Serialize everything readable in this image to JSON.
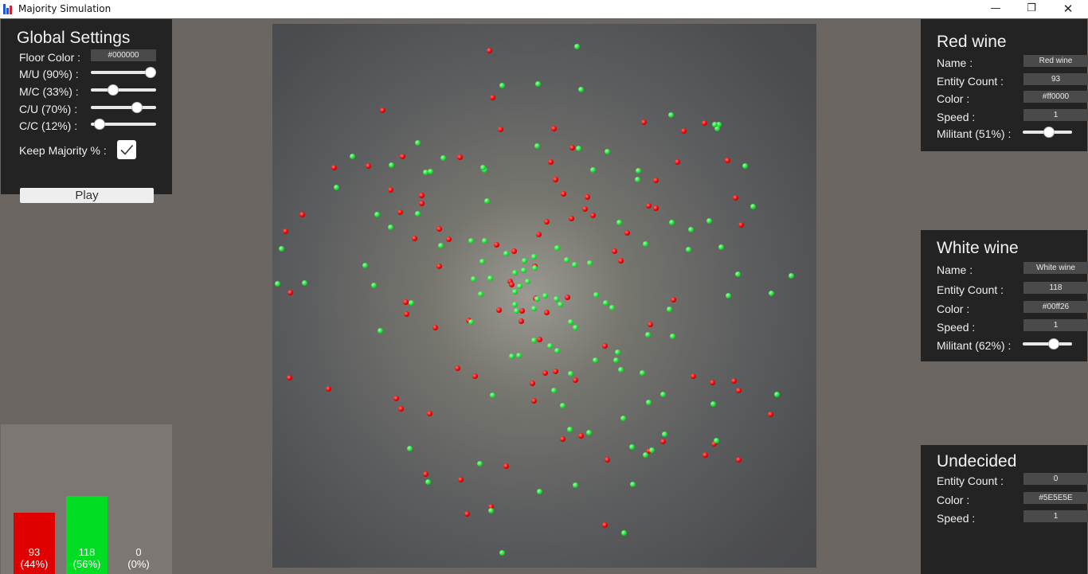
{
  "window": {
    "title": "Majority Simulation",
    "minimize": "—",
    "restore": "❐",
    "close": "✕",
    "icon": "bar-chart-app-icon"
  },
  "global": {
    "heading": "Global Settings",
    "floor_label": "Floor Color :",
    "floor_value": "#000000",
    "mu_label": "M/U (90%) :",
    "mu_value": 0.9,
    "mc_label": "M/C (33%) :",
    "mc_value": 0.33,
    "cu_label": "C/U (70%) :",
    "cu_value": 0.7,
    "cc_label": "C/C (12%) :",
    "cc_value": 0.12,
    "keep_label": "Keep Majority % :",
    "keep_checked": true,
    "play_label": "Play"
  },
  "red": {
    "heading": "Red wine",
    "name_label": "Name :",
    "name_value": "Red wine",
    "count_label": "Entity Count :",
    "count_value": "93",
    "color_label": "Color :",
    "color_value": "#ff0000",
    "speed_label": "Speed :",
    "speed_value": "1",
    "militant_label": "Militant (51%) :",
    "militant_value": 0.51
  },
  "white": {
    "heading": "White wine",
    "name_label": "Name :",
    "name_value": "White wine",
    "count_label": "Entity Count :",
    "count_value": "118",
    "color_label": "Color :",
    "color_value": "#00ff26",
    "speed_label": "Speed :",
    "speed_value": "1",
    "militant_label": "Militant (62%) :",
    "militant_value": 0.62
  },
  "undecided": {
    "heading": "Undecided",
    "count_label": "Entity Count :",
    "count_value": "0",
    "color_label": "Color :",
    "color_value": "#5E5E5E",
    "speed_label": "Speed :",
    "speed_value": "1"
  },
  "stats": {
    "red_count": "93",
    "red_pct": "(44%)",
    "red_share": 0.44,
    "red_color": "#e00000",
    "white_count": "118",
    "white_pct": "(56%)",
    "white_share": 0.56,
    "white_color": "#00dd22",
    "und_count": "0",
    "und_pct": "(0%)",
    "und_share": 0
  }
}
